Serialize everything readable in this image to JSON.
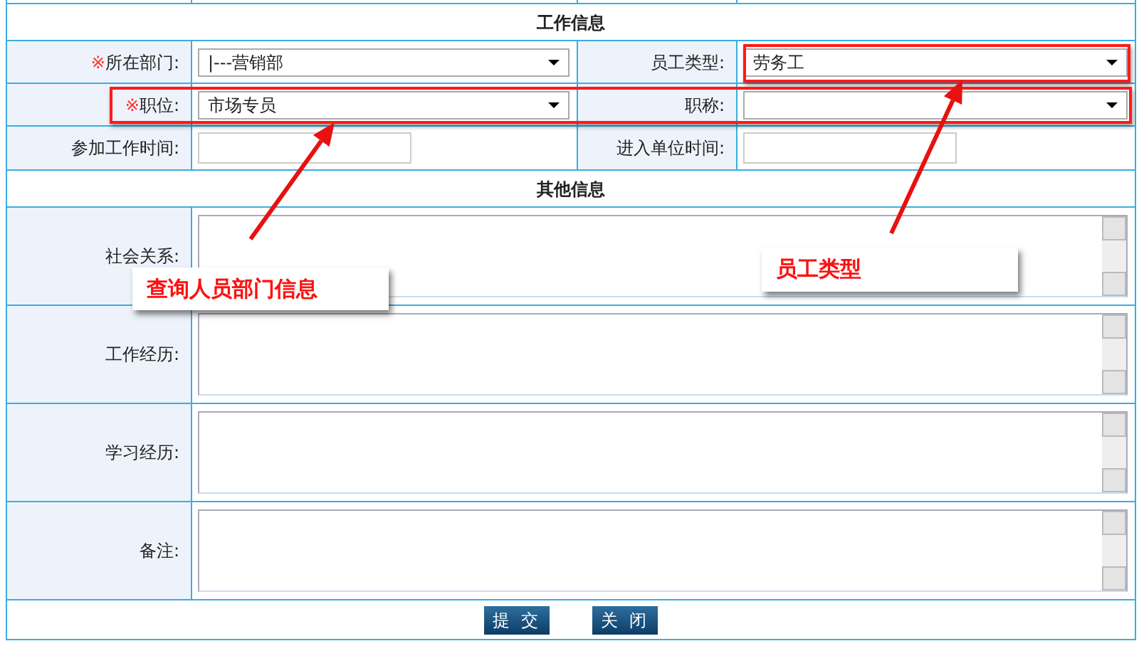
{
  "work_info": {
    "title": "工作信息",
    "rows": [
      {
        "fields": [
          {
            "label": "所在部门:",
            "required_mark": "※",
            "kind": "select",
            "value": "|---营销部"
          },
          {
            "label": "员工类型:",
            "kind": "select",
            "value": "劳务工"
          }
        ]
      },
      {
        "fields": [
          {
            "label": "职位:",
            "required_mark": "※",
            "kind": "select",
            "value": "市场专员"
          },
          {
            "label": "职称:",
            "kind": "select"
          }
        ]
      },
      {
        "fields": [
          {
            "label": "参加工作时间:",
            "kind": "input"
          },
          {
            "label": "进入单位时间:",
            "kind": "input"
          }
        ]
      }
    ]
  },
  "other_info": {
    "title": "其他信息",
    "fields": [
      {
        "label": "社会关系:"
      },
      {
        "label": "工作经历:"
      },
      {
        "label": "学习经历:"
      },
      {
        "label": "备注:"
      }
    ]
  },
  "buttons": [
    "提 交",
    "关 闭"
  ],
  "annotations": [
    {
      "text": "查询人员部门信息"
    },
    {
      "text": "员工类型"
    }
  ]
}
